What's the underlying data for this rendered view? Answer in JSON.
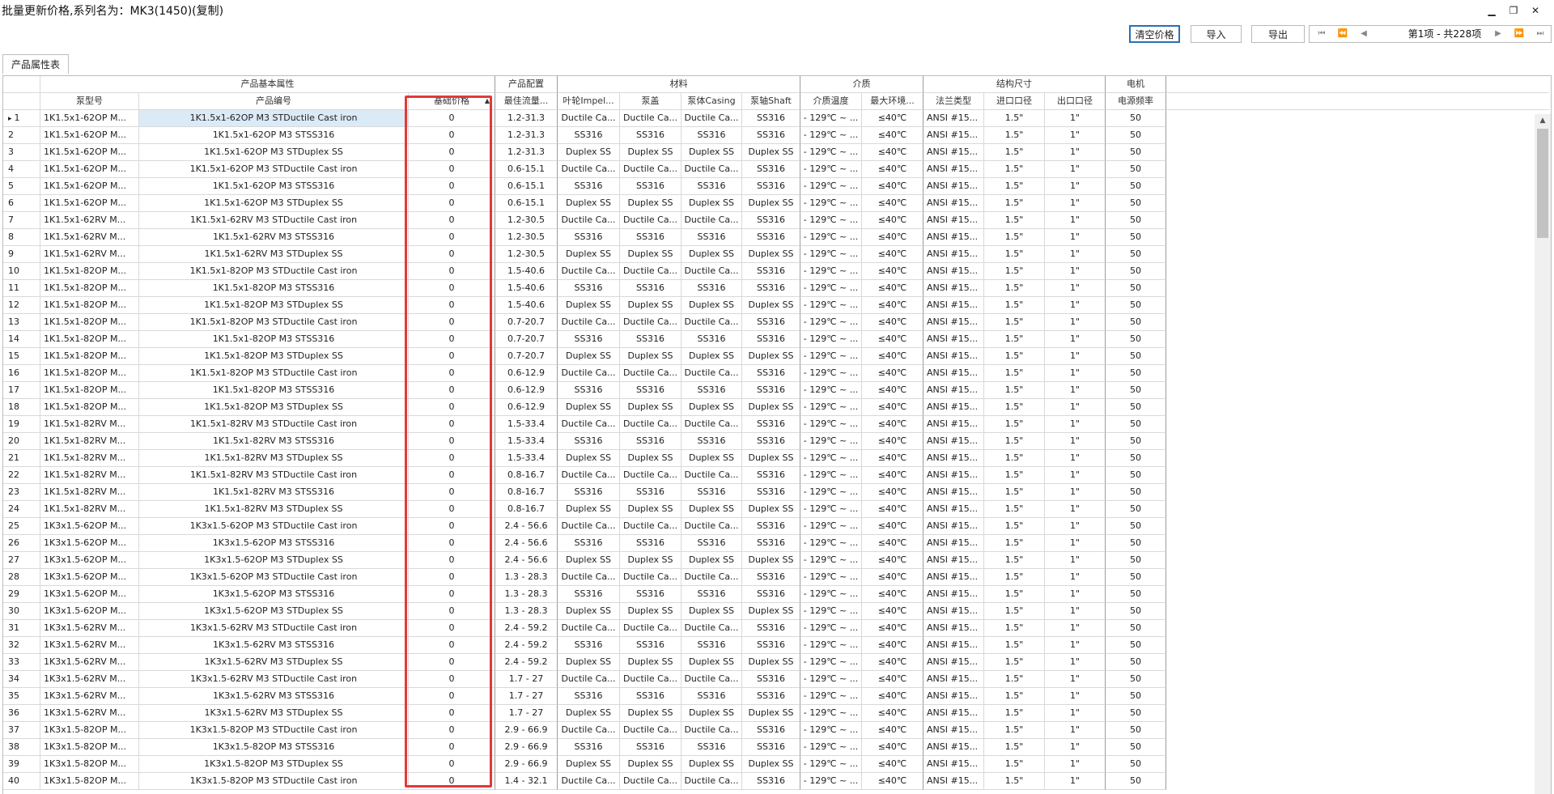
{
  "window": {
    "title": "批量更新价格,系列名为：MK3(1450)(复制)",
    "min_icon": "minimize-icon",
    "max_icon": "restore-icon",
    "close_icon": "close-icon"
  },
  "toolbar": {
    "clear_label": "清空价格",
    "import_label": "导入",
    "export_label": "导出"
  },
  "pager": {
    "info": "第1项 - 共228项",
    "first": "⏮",
    "prev_page": "⏪",
    "prev": "◀",
    "next": "▶",
    "next_page": "⏩",
    "last": "⏭"
  },
  "tab": {
    "label": "产品属性表"
  },
  "groups": [
    {
      "label": "产品基本属性"
    },
    {
      "label": "产品配置"
    },
    {
      "label": "材料"
    },
    {
      "label": "介质"
    },
    {
      "label": "结构尺寸"
    },
    {
      "label": "电机"
    }
  ],
  "columns": [
    {
      "label": "泵型号"
    },
    {
      "label": "产品编号"
    },
    {
      "label": "基础价格"
    },
    {
      "label": "最佳流量..."
    },
    {
      "label": "叶轮Impel..."
    },
    {
      "label": "泵盖"
    },
    {
      "label": "泵体Casing"
    },
    {
      "label": "泵轴Shaft"
    },
    {
      "label": "介质温度"
    },
    {
      "label": "最大环境..."
    },
    {
      "label": "法兰类型"
    },
    {
      "label": "进口口径"
    },
    {
      "label": "出口口径"
    },
    {
      "label": "电源频率"
    }
  ],
  "constants": {
    "temp": "- 129℃ ~ ...",
    "env": "≤40℃",
    "flange": "ANSI #15...",
    "inlet": "1.5\"",
    "outlet": "1\"",
    "freq": "50",
    "price": "0"
  },
  "rows": [
    [
      "1",
      "1K1.5x1-62OP M...",
      "1K1.5x1-62OP M3 STDuctile Cast iron",
      "1.2-31.3",
      "Ductile Ca...",
      "Ductile Ca...",
      "Ductile Ca...",
      "SS316"
    ],
    [
      "2",
      "1K1.5x1-62OP M...",
      "1K1.5x1-62OP M3 STSS316",
      "1.2-31.3",
      "SS316",
      "SS316",
      "SS316",
      "SS316"
    ],
    [
      "3",
      "1K1.5x1-62OP M...",
      "1K1.5x1-62OP M3 STDuplex SS",
      "1.2-31.3",
      "Duplex SS",
      "Duplex SS",
      "Duplex SS",
      "Duplex SS"
    ],
    [
      "4",
      "1K1.5x1-62OP M...",
      "1K1.5x1-62OP M3 STDuctile Cast iron",
      "0.6-15.1",
      "Ductile Ca...",
      "Ductile Ca...",
      "Ductile Ca...",
      "SS316"
    ],
    [
      "5",
      "1K1.5x1-62OP M...",
      "1K1.5x1-62OP M3 STSS316",
      "0.6-15.1",
      "SS316",
      "SS316",
      "SS316",
      "SS316"
    ],
    [
      "6",
      "1K1.5x1-62OP M...",
      "1K1.5x1-62OP M3 STDuplex SS",
      "0.6-15.1",
      "Duplex SS",
      "Duplex SS",
      "Duplex SS",
      "Duplex SS"
    ],
    [
      "7",
      "1K1.5x1-62RV M...",
      "1K1.5x1-62RV M3 STDuctile Cast iron",
      "1.2-30.5",
      "Ductile Ca...",
      "Ductile Ca...",
      "Ductile Ca...",
      "SS316"
    ],
    [
      "8",
      "1K1.5x1-62RV M...",
      "1K1.5x1-62RV M3 STSS316",
      "1.2-30.5",
      "SS316",
      "SS316",
      "SS316",
      "SS316"
    ],
    [
      "9",
      "1K1.5x1-62RV M...",
      "1K1.5x1-62RV M3 STDuplex SS",
      "1.2-30.5",
      "Duplex SS",
      "Duplex SS",
      "Duplex SS",
      "Duplex SS"
    ],
    [
      "10",
      "1K1.5x1-82OP M...",
      "1K1.5x1-82OP M3 STDuctile Cast iron",
      "1.5-40.6",
      "Ductile Ca...",
      "Ductile Ca...",
      "Ductile Ca...",
      "SS316"
    ],
    [
      "11",
      "1K1.5x1-82OP M...",
      "1K1.5x1-82OP M3 STSS316",
      "1.5-40.6",
      "SS316",
      "SS316",
      "SS316",
      "SS316"
    ],
    [
      "12",
      "1K1.5x1-82OP M...",
      "1K1.5x1-82OP M3 STDuplex SS",
      "1.5-40.6",
      "Duplex SS",
      "Duplex SS",
      "Duplex SS",
      "Duplex SS"
    ],
    [
      "13",
      "1K1.5x1-82OP M...",
      "1K1.5x1-82OP M3 STDuctile Cast iron",
      "0.7-20.7",
      "Ductile Ca...",
      "Ductile Ca...",
      "Ductile Ca...",
      "SS316"
    ],
    [
      "14",
      "1K1.5x1-82OP M...",
      "1K1.5x1-82OP M3 STSS316",
      "0.7-20.7",
      "SS316",
      "SS316",
      "SS316",
      "SS316"
    ],
    [
      "15",
      "1K1.5x1-82OP M...",
      "1K1.5x1-82OP M3 STDuplex SS",
      "0.7-20.7",
      "Duplex SS",
      "Duplex SS",
      "Duplex SS",
      "Duplex SS"
    ],
    [
      "16",
      "1K1.5x1-82OP M...",
      "1K1.5x1-82OP M3 STDuctile Cast iron",
      "0.6-12.9",
      "Ductile Ca...",
      "Ductile Ca...",
      "Ductile Ca...",
      "SS316"
    ],
    [
      "17",
      "1K1.5x1-82OP M...",
      "1K1.5x1-82OP M3 STSS316",
      "0.6-12.9",
      "SS316",
      "SS316",
      "SS316",
      "SS316"
    ],
    [
      "18",
      "1K1.5x1-82OP M...",
      "1K1.5x1-82OP M3 STDuplex SS",
      "0.6-12.9",
      "Duplex SS",
      "Duplex SS",
      "Duplex SS",
      "Duplex SS"
    ],
    [
      "19",
      "1K1.5x1-82RV M...",
      "1K1.5x1-82RV M3 STDuctile Cast iron",
      "1.5-33.4",
      "Ductile Ca...",
      "Ductile Ca...",
      "Ductile Ca...",
      "SS316"
    ],
    [
      "20",
      "1K1.5x1-82RV M...",
      "1K1.5x1-82RV M3 STSS316",
      "1.5-33.4",
      "SS316",
      "SS316",
      "SS316",
      "SS316"
    ],
    [
      "21",
      "1K1.5x1-82RV M...",
      "1K1.5x1-82RV M3 STDuplex SS",
      "1.5-33.4",
      "Duplex SS",
      "Duplex SS",
      "Duplex SS",
      "Duplex SS"
    ],
    [
      "22",
      "1K1.5x1-82RV M...",
      "1K1.5x1-82RV M3 STDuctile Cast iron",
      "0.8-16.7",
      "Ductile Ca...",
      "Ductile Ca...",
      "Ductile Ca...",
      "SS316"
    ],
    [
      "23",
      "1K1.5x1-82RV M...",
      "1K1.5x1-82RV M3 STSS316",
      "0.8-16.7",
      "SS316",
      "SS316",
      "SS316",
      "SS316"
    ],
    [
      "24",
      "1K1.5x1-82RV M...",
      "1K1.5x1-82RV M3 STDuplex SS",
      "0.8-16.7",
      "Duplex SS",
      "Duplex SS",
      "Duplex SS",
      "Duplex SS"
    ],
    [
      "25",
      "1K3x1.5-62OP M...",
      "1K3x1.5-62OP M3 STDuctile Cast iron",
      "2.4 - 56.6",
      "Ductile Ca...",
      "Ductile Ca...",
      "Ductile Ca...",
      "SS316"
    ],
    [
      "26",
      "1K3x1.5-62OP M...",
      "1K3x1.5-62OP M3 STSS316",
      "2.4 - 56.6",
      "SS316",
      "SS316",
      "SS316",
      "SS316"
    ],
    [
      "27",
      "1K3x1.5-62OP M...",
      "1K3x1.5-62OP M3 STDuplex SS",
      "2.4 - 56.6",
      "Duplex SS",
      "Duplex SS",
      "Duplex SS",
      "Duplex SS"
    ],
    [
      "28",
      "1K3x1.5-62OP M...",
      "1K3x1.5-62OP M3 STDuctile Cast iron",
      "1.3 - 28.3",
      "Ductile Ca...",
      "Ductile Ca...",
      "Ductile Ca...",
      "SS316"
    ],
    [
      "29",
      "1K3x1.5-62OP M...",
      "1K3x1.5-62OP M3 STSS316",
      "1.3 - 28.3",
      "SS316",
      "SS316",
      "SS316",
      "SS316"
    ],
    [
      "30",
      "1K3x1.5-62OP M...",
      "1K3x1.5-62OP M3 STDuplex SS",
      "1.3 - 28.3",
      "Duplex SS",
      "Duplex SS",
      "Duplex SS",
      "Duplex SS"
    ],
    [
      "31",
      "1K3x1.5-62RV M...",
      "1K3x1.5-62RV M3 STDuctile Cast iron",
      "2.4 - 59.2",
      "Ductile Ca...",
      "Ductile Ca...",
      "Ductile Ca...",
      "SS316"
    ],
    [
      "32",
      "1K3x1.5-62RV M...",
      "1K3x1.5-62RV M3 STSS316",
      "2.4 - 59.2",
      "SS316",
      "SS316",
      "SS316",
      "SS316"
    ],
    [
      "33",
      "1K3x1.5-62RV M...",
      "1K3x1.5-62RV M3 STDuplex SS",
      "2.4 - 59.2",
      "Duplex SS",
      "Duplex SS",
      "Duplex SS",
      "Duplex SS"
    ],
    [
      "34",
      "1K3x1.5-62RV M...",
      "1K3x1.5-62RV M3 STDuctile Cast iron",
      "1.7 - 27",
      "Ductile Ca...",
      "Ductile Ca...",
      "Ductile Ca...",
      "SS316"
    ],
    [
      "35",
      "1K3x1.5-62RV M...",
      "1K3x1.5-62RV M3 STSS316",
      "1.7 - 27",
      "SS316",
      "SS316",
      "SS316",
      "SS316"
    ],
    [
      "36",
      "1K3x1.5-62RV M...",
      "1K3x1.5-62RV M3 STDuplex SS",
      "1.7 - 27",
      "Duplex SS",
      "Duplex SS",
      "Duplex SS",
      "Duplex SS"
    ],
    [
      "37",
      "1K3x1.5-82OP M...",
      "1K3x1.5-82OP M3 STDuctile Cast iron",
      "2.9 - 66.9",
      "Ductile Ca...",
      "Ductile Ca...",
      "Ductile Ca...",
      "SS316"
    ],
    [
      "38",
      "1K3x1.5-82OP M...",
      "1K3x1.5-82OP M3 STSS316",
      "2.9 - 66.9",
      "SS316",
      "SS316",
      "SS316",
      "SS316"
    ],
    [
      "39",
      "1K3x1.5-82OP M...",
      "1K3x1.5-82OP M3 STDuplex SS",
      "2.9 - 66.9",
      "Duplex SS",
      "Duplex SS",
      "Duplex SS",
      "Duplex SS"
    ],
    [
      "40",
      "1K3x1.5-82OP M...",
      "1K3x1.5-82OP M3 STDuctile Cast iron",
      "1.4 - 32.1",
      "Ductile Ca...",
      "Ductile Ca...",
      "Ductile Ca...",
      "SS316"
    ]
  ],
  "selected_row": "1",
  "sort_indicator": "▲",
  "current_row_marker": "▸",
  "scroll_up": "▲",
  "colors": {
    "accent": "#2a6fb5",
    "highlight_box": "#e03a3a",
    "selected_cell": "#dbeaf7"
  }
}
